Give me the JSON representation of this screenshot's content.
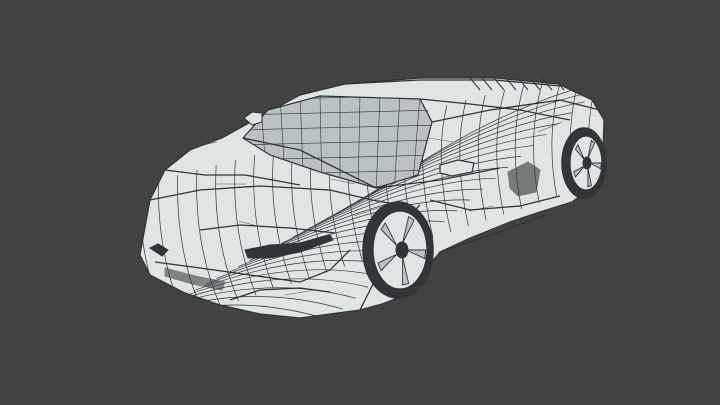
{
  "viewport": {
    "background_color": "#424242",
    "model": {
      "subject": "sports-car",
      "display_mode": "wireframe",
      "surface_color": "#dfe5e5",
      "wire_color": "#2f3436",
      "shadow_color": "#b9c1c2",
      "tire_color": "#333638"
    }
  }
}
